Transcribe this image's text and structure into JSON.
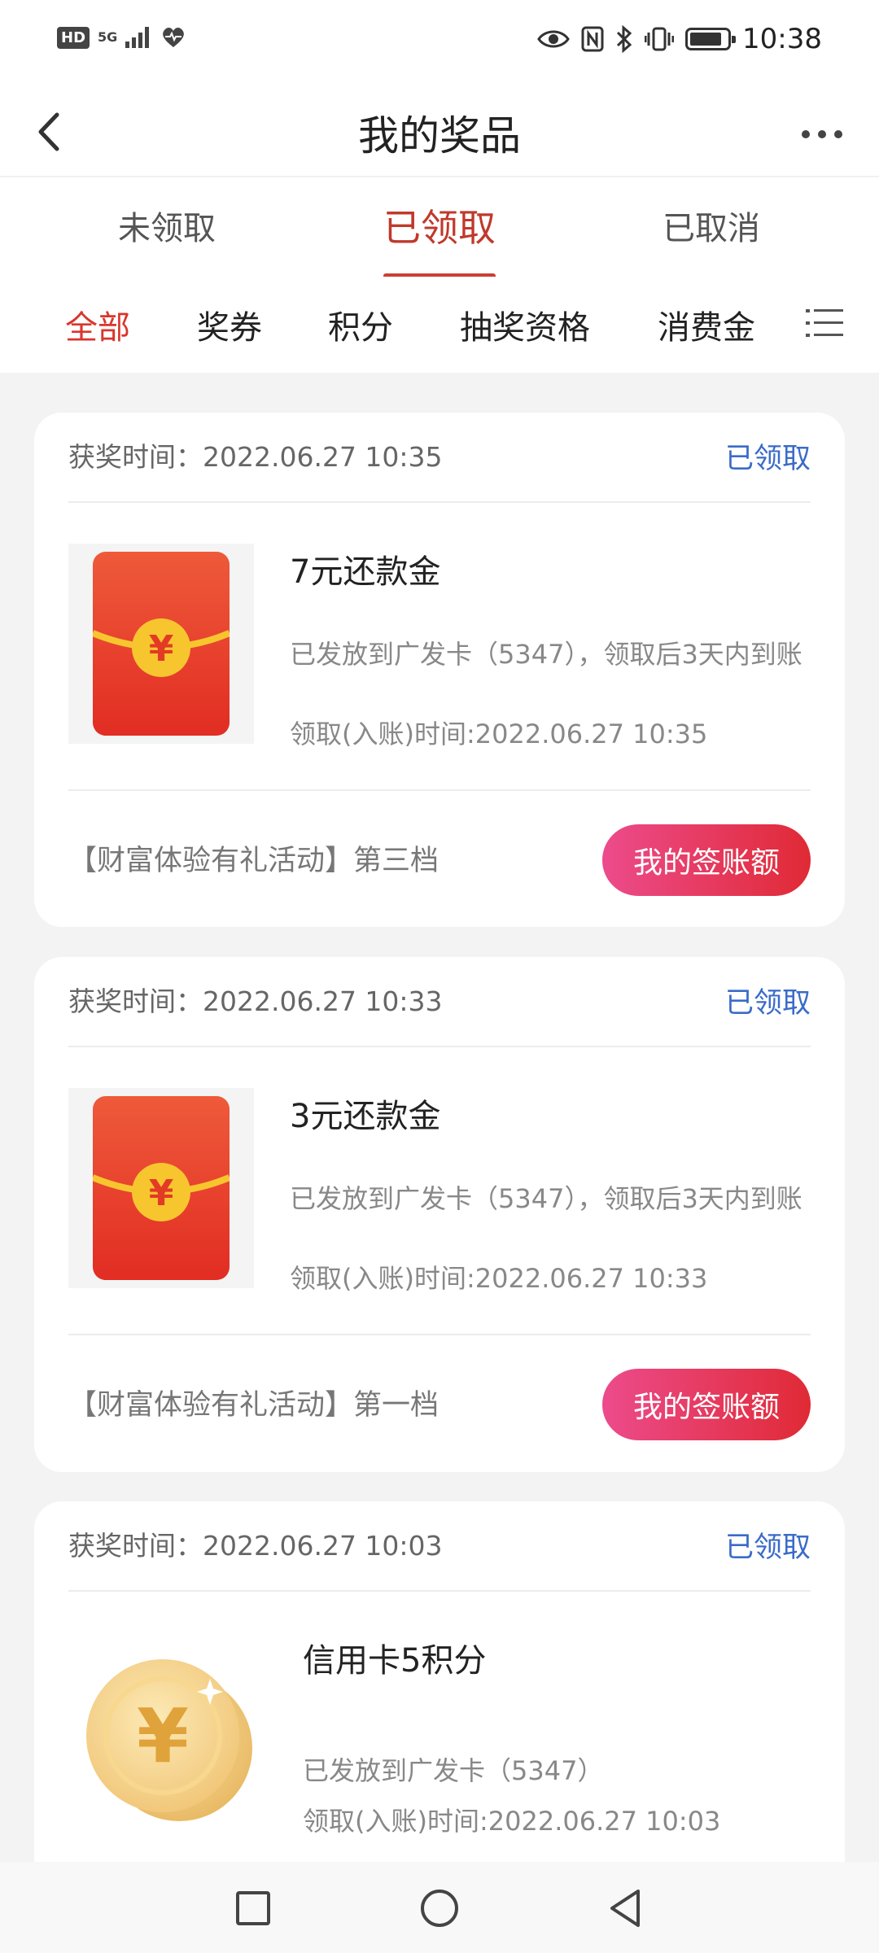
{
  "status_bar": {
    "left": {
      "hd": "HD",
      "network": "5G"
    },
    "time": "10:38",
    "icons": [
      "hd-icon",
      "signal-icon",
      "health-icon",
      "eye-icon",
      "nfc-icon",
      "bluetooth-icon",
      "vibrate-icon",
      "battery-icon"
    ]
  },
  "header": {
    "title": "我的奖品",
    "back_icon": "chevron-left-icon",
    "more_icon": "more-horizontal-icon"
  },
  "tabs": [
    {
      "label": "未领取",
      "active": false
    },
    {
      "label": "已领取",
      "active": true
    },
    {
      "label": "已取消",
      "active": false
    }
  ],
  "filters": [
    {
      "label": "全部",
      "active": true
    },
    {
      "label": "奖券",
      "active": false
    },
    {
      "label": "积分",
      "active": false
    },
    {
      "label": "抽奖资格",
      "active": false
    },
    {
      "label": "消费金",
      "active": false
    }
  ],
  "colors": {
    "accent_red": "#c94034",
    "status_blue": "#3a6bc8",
    "button_gradient_start": "#ec4b8c",
    "button_gradient_end": "#e02a35"
  },
  "cards": [
    {
      "award_time": "获奖时间：2022.06.27 10:35",
      "status": "已领取",
      "icon": "red-envelope-icon",
      "name": "7元还款金",
      "desc": "已发放到广发卡（5347），领取后3天内到账",
      "claim_time": "领取(入账)时间:2022.06.27 10:35",
      "activity": "【财富体验有礼活动】第三档",
      "button": "我的签账额"
    },
    {
      "award_time": "获奖时间：2022.06.27 10:33",
      "status": "已领取",
      "icon": "red-envelope-icon",
      "name": "3元还款金",
      "desc": "已发放到广发卡（5347），领取后3天内到账",
      "claim_time": "领取(入账)时间:2022.06.27 10:33",
      "activity": "【财富体验有礼活动】第一档",
      "button": "我的签账额"
    },
    {
      "award_time": "获奖时间：2022.06.27 10:03",
      "status": "已领取",
      "icon": "gold-coin-icon",
      "name": "信用卡5积分",
      "desc": "已发放到广发卡（5347）",
      "claim_time": "领取(入账)时间:2022.06.27 10:03"
    }
  ],
  "nav_bar": {
    "icons": [
      "recent-apps-icon",
      "home-icon",
      "back-triangle-icon"
    ]
  }
}
